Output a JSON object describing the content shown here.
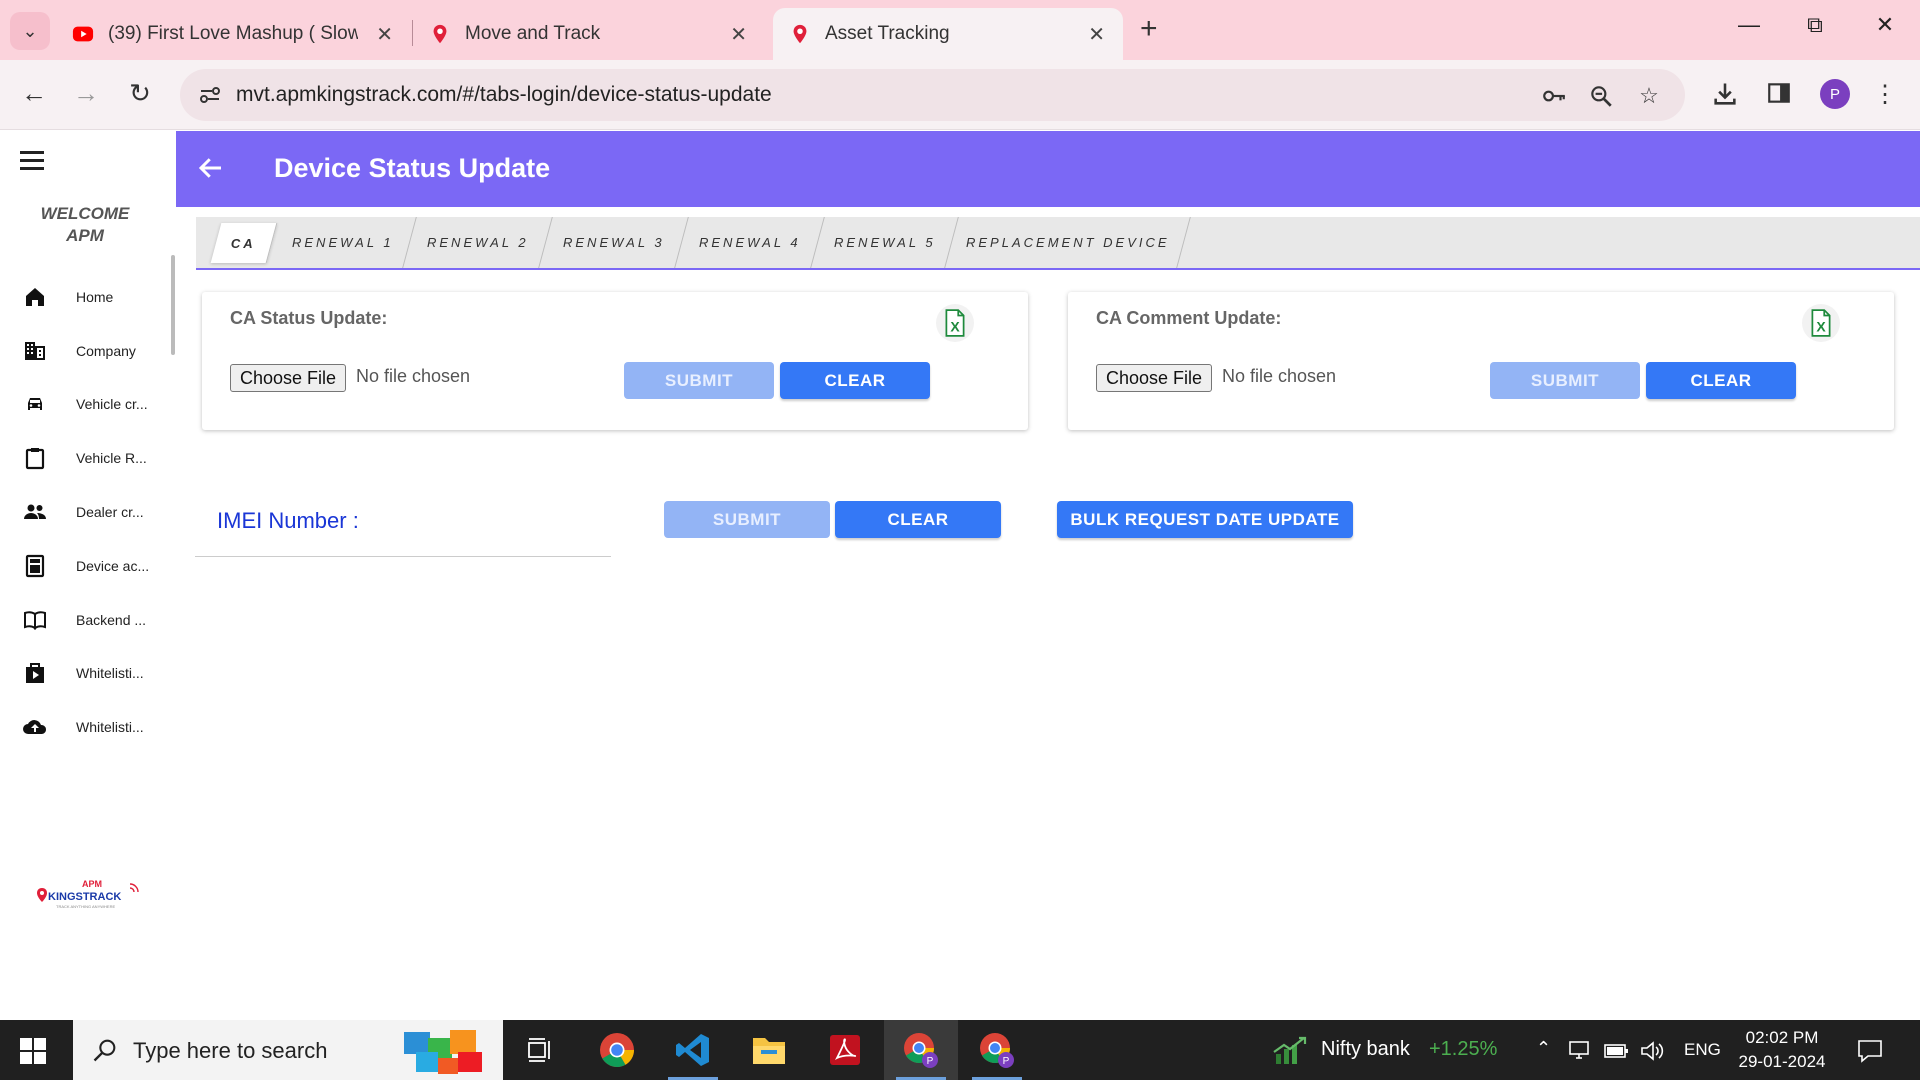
{
  "browser": {
    "tabs": [
      {
        "title": "(39) First Love Mashup ( Slowed",
        "icon": "youtube-icon"
      },
      {
        "title": "Move and Track",
        "icon": "location-pin-icon"
      },
      {
        "title": "Asset Tracking",
        "icon": "location-pin-icon"
      }
    ],
    "active_tab": 2,
    "url": "mvt.apmkingstrack.com/#/tabs-login/device-status-update",
    "profile_initial": "P"
  },
  "sidebar": {
    "welcome_line1": "WELCOME",
    "welcome_line2": "APM",
    "items": [
      {
        "label": "Home",
        "icon": "home-icon"
      },
      {
        "label": "Company",
        "icon": "building-icon"
      },
      {
        "label": "Vehicle cr...",
        "icon": "car-icon"
      },
      {
        "label": "Vehicle R...",
        "icon": "clipboard-icon"
      },
      {
        "label": "Dealer cr...",
        "icon": "people-icon"
      },
      {
        "label": "Device ac...",
        "icon": "calculator-icon"
      },
      {
        "label": "Backend ...",
        "icon": "book-icon"
      },
      {
        "label": "Whitelisti...",
        "icon": "shopping-bag-icon"
      },
      {
        "label": "Whitelisti...",
        "icon": "cloud-upload-icon"
      }
    ],
    "logo_text": "APM KINGSTRACK",
    "logo_tagline": "TRACK ANYTHING ANYWHERE"
  },
  "header": {
    "title": "Device Status Update"
  },
  "tabs": [
    "CA",
    "RENEWAL 1",
    "RENEWAL 2",
    "RENEWAL 3",
    "RENEWAL 4",
    "RENEWAL 5",
    "REPLACEMENT DEVICE"
  ],
  "active_tab": 0,
  "cards": {
    "status": {
      "title": "CA Status Update:",
      "choose_file": "Choose File",
      "file_status": "No file chosen",
      "submit": "SUBMIT",
      "clear": "CLEAR"
    },
    "comment": {
      "title": "CA Comment Update:",
      "choose_file": "Choose File",
      "file_status": "No file chosen",
      "submit": "SUBMIT",
      "clear": "CLEAR"
    }
  },
  "imei": {
    "label": "IMEI Number :",
    "value": "",
    "submit": "SUBMIT",
    "clear": "CLEAR",
    "bulk": "BULK REQUEST DATE UPDATE"
  },
  "taskbar": {
    "search_placeholder": "Type here to search",
    "ticker_name": "Nifty bank",
    "ticker_change": "+1.25%",
    "language": "ENG",
    "time": "02:02 PM",
    "date": "29-01-2024"
  },
  "colors": {
    "header_bg": "#7b68f5",
    "primary_button": "#3478f6",
    "disabled_button": "#93b4f5",
    "imei_label": "#1a36d6",
    "tabstrip_bg": "#fbd3dc",
    "ticker_up": "#4caf50"
  }
}
